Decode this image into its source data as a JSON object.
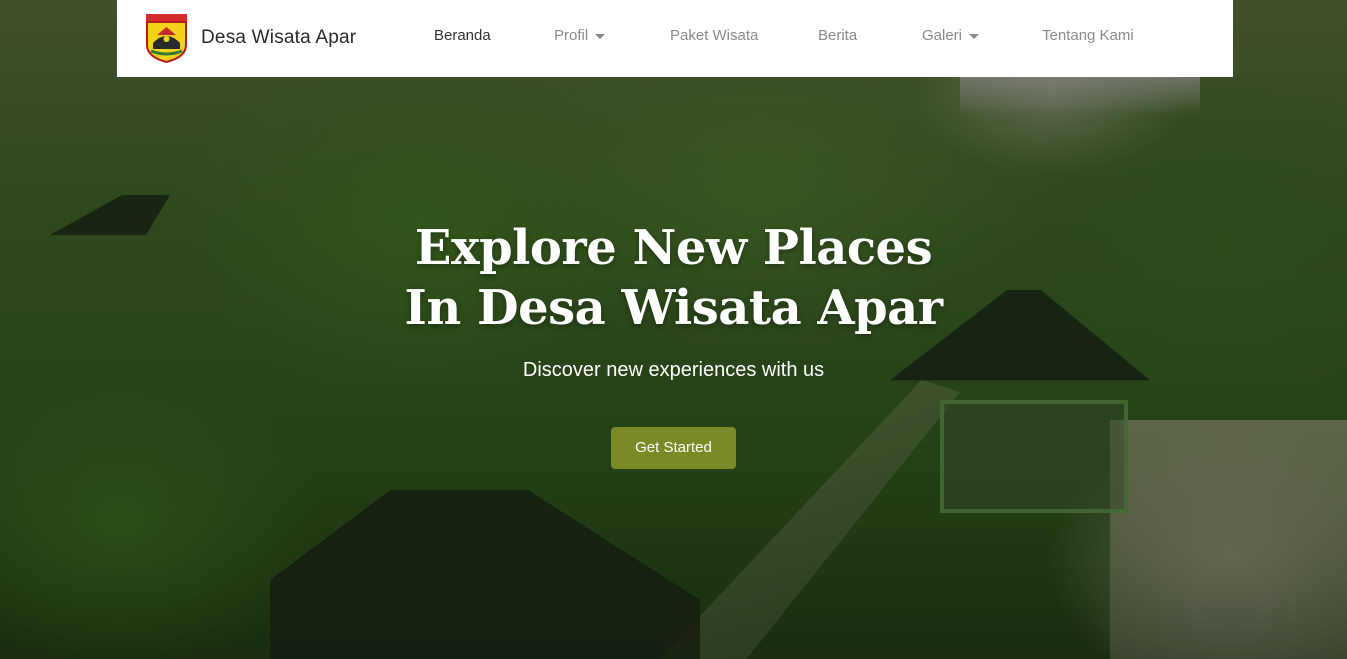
{
  "navbar": {
    "brand_name": "Desa Wisata Apar",
    "logo_icon": "city-crest-icon",
    "items": [
      {
        "label": "Beranda",
        "active": true,
        "dropdown": false
      },
      {
        "label": "Profil",
        "active": false,
        "dropdown": true
      },
      {
        "label": "Paket Wisata",
        "active": false,
        "dropdown": false
      },
      {
        "label": "Berita",
        "active": false,
        "dropdown": false
      },
      {
        "label": "Galeri",
        "active": false,
        "dropdown": true
      },
      {
        "label": "Tentang Kami",
        "active": false,
        "dropdown": false
      }
    ]
  },
  "hero": {
    "title_line1": "Explore New Places",
    "title_line2": "In Desa Wisata Apar",
    "subtitle": "Discover new experiences with us",
    "cta_label": "Get Started"
  },
  "colors": {
    "accent": "#7a8a25",
    "nav_bg": "#ffffff",
    "nav_text": "#8a8a8a",
    "nav_active_text": "#333333"
  }
}
